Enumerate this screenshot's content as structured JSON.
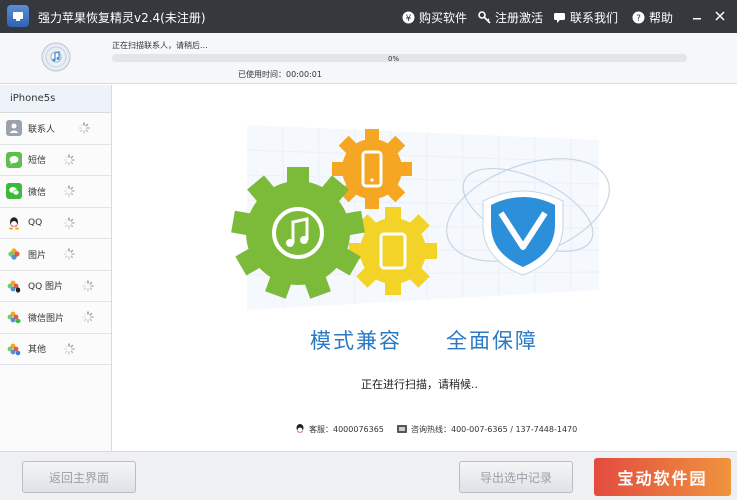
{
  "titlebar": {
    "title": "强力苹果恢复精灵v2.4(未注册)",
    "menu": [
      {
        "label": "购买软件",
        "icon": "yen-icon"
      },
      {
        "label": "注册激活",
        "icon": "key-icon"
      },
      {
        "label": "联系我们",
        "icon": "chat-icon"
      },
      {
        "label": "帮助",
        "icon": "help-icon"
      }
    ]
  },
  "progress": {
    "status": "正在扫描联系人，请稍后...",
    "percent_label": "0%",
    "percent": 0,
    "elapsed": "已使用时间：00:00:01"
  },
  "sidebar": {
    "device": "iPhone5s",
    "items": [
      {
        "label": "联系人",
        "icon": "contacts-icon"
      },
      {
        "label": "短信",
        "icon": "messages-icon"
      },
      {
        "label": "微信",
        "icon": "wechat-icon"
      },
      {
        "label": "QQ",
        "icon": "qq-icon"
      },
      {
        "label": "图片",
        "icon": "photos-icon"
      },
      {
        "label": "QQ 图片",
        "icon": "qq-photos-icon"
      },
      {
        "label": "微信图片",
        "icon": "wechat-photos-icon"
      },
      {
        "label": "其他",
        "icon": "other-icon"
      }
    ]
  },
  "main": {
    "slogan_left": "模式兼容",
    "slogan_right": "全面保障",
    "scanning": "正在进行扫描，请稍候..",
    "support_qq": "客服：4000076365",
    "hotline": "咨询热线：400-007-6365 / 137-7448-1470"
  },
  "footer": {
    "back_label": "返回主界面",
    "export_label": "导出选中记录",
    "watermark": "宝动软件园"
  },
  "colors": {
    "titlebar": "#35383d",
    "accent_blue": "#2979c6",
    "gear_green": "#7cba3a",
    "gear_orange": "#f5a623",
    "gear_yellow": "#f3d327",
    "shield_blue": "#2b8fd9"
  }
}
